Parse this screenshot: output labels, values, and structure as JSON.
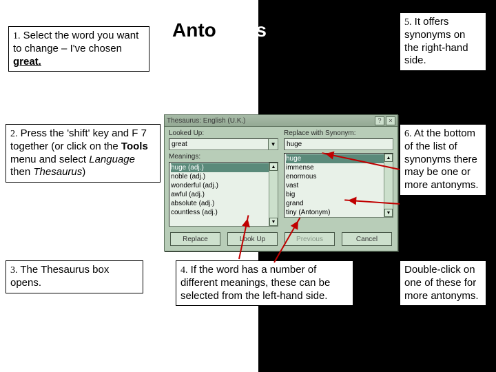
{
  "heading": "Antonyms",
  "notes": {
    "n1": {
      "num": "1.",
      "body1": " Select the word you want to change – I've chosen ",
      "boldUnder": "great."
    },
    "n2": {
      "num": "2.",
      "body1": " Press the 'shift' key and F 7 together (or click on the ",
      "bold1": "Tools",
      "body2": " menu and select ",
      "ital1": "Language",
      "body3": " then ",
      "ital2": "Thesaurus",
      "body4": ")"
    },
    "n3": {
      "num": "3.",
      "body1": " The Thesaurus box opens."
    },
    "n4": {
      "num": "4.",
      "body1": " If the word has a number of different meanings, these can be selected from the left-hand side."
    },
    "n5": {
      "num": "5.",
      "body1": " It offers synonyms on the right-hand side."
    },
    "n6": {
      "num": "6.",
      "body1": " At the bottom of the list of synonyms there may be one or more antonyms."
    },
    "n7": {
      "body1": "Double-click on one of these for more antonyms."
    }
  },
  "dialog": {
    "title": "Thesaurus: English (U.K.)",
    "helpGlyph": "?",
    "closeGlyph": "×",
    "lookedUpLabel": "Looked Up:",
    "lookedUpValue": "great",
    "meaningsLabel": "Meanings:",
    "meanings": [
      "huge (adj.)",
      "noble (adj.)",
      "wonderful (adj.)",
      "awful (adj.)",
      "absolute (adj.)",
      "countless (adj.)"
    ],
    "replaceLabel": "Replace with Synonym:",
    "replaceValue": "huge",
    "synonyms": [
      "huge",
      "immense",
      "enormous",
      "vast",
      "big",
      "grand",
      "tiny (Antonym)"
    ],
    "buttons": {
      "replace": "Replace",
      "lookup": "Look Up",
      "previous": "Previous",
      "cancel": "Cancel"
    }
  }
}
